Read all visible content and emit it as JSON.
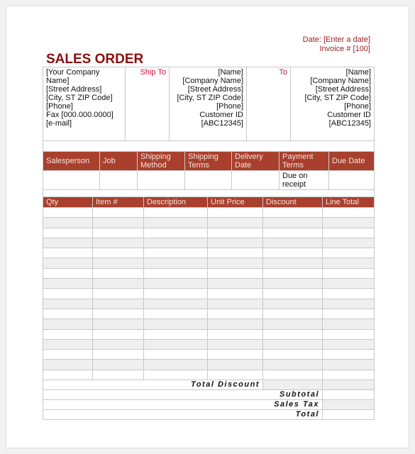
{
  "header": {
    "date": "Date: [Enter a date]",
    "invoice": "Invoice # [100]",
    "title": "SALES ORDER"
  },
  "company": [
    "[Your Company Name]",
    "[Street Address]",
    "[City, ST  ZIP Code]",
    "[Phone]",
    "Fax [000.000.0000]",
    "[e-mail]"
  ],
  "ship_to": {
    "label": "Ship To",
    "lines": [
      "[Name]",
      "[Company Name]",
      "[Street Address]",
      "[City, ST  ZIP Code]",
      "[Phone]",
      "Customer ID",
      "[ABC12345]"
    ]
  },
  "to": {
    "label": "To",
    "lines": [
      "[Name]",
      "[Company Name]",
      "[Street Address]",
      "[City, ST  ZIP Code]",
      "[Phone]",
      "Customer ID",
      "[ABC12345]"
    ]
  },
  "order_info": {
    "headers": [
      "Salesperson",
      "Job",
      "Shipping Method",
      "Shipping Terms",
      "Delivery Date",
      "Payment Terms",
      "Due Date"
    ],
    "values": [
      "",
      "",
      "",
      "",
      "",
      "Due on receipt",
      ""
    ]
  },
  "items": {
    "headers": [
      "Qty",
      "Item #",
      "Description",
      "Unit Price",
      "Discount",
      "Line Total"
    ],
    "row_count": 17
  },
  "totals": {
    "total_discount": "Total Discount",
    "subtotal": "Subtotal",
    "sales_tax": "Sales Tax",
    "total": "Total"
  },
  "colors": {
    "header_bg": "#a9402e",
    "title": "#8b0f0f",
    "label": "#d0103a"
  }
}
